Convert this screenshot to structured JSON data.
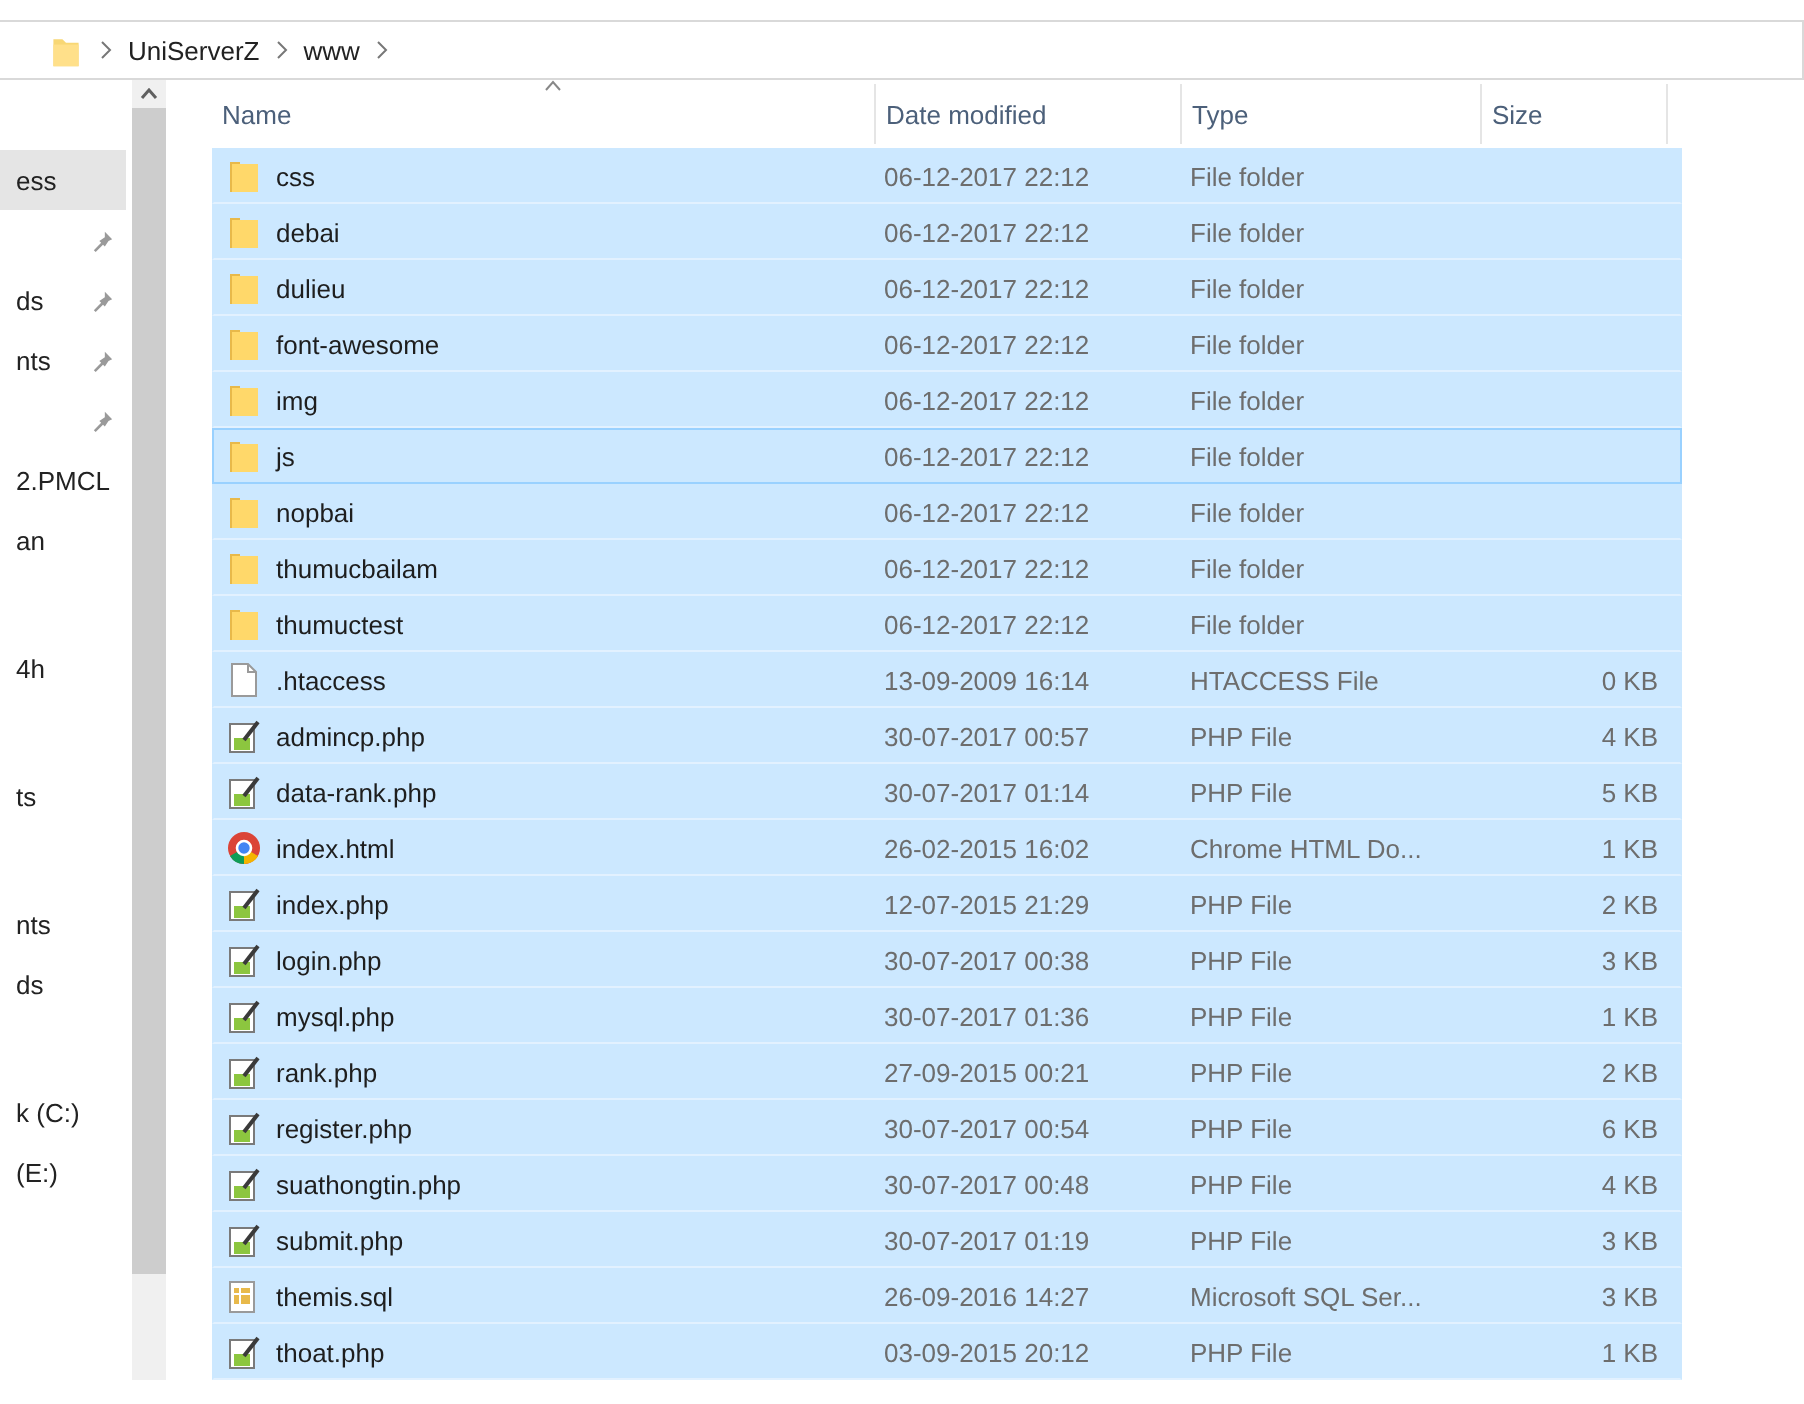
{
  "address_bar": {
    "crumbs": [
      "UniServerZ",
      "www"
    ]
  },
  "sidebar": {
    "groups": [
      {
        "items": [
          {
            "label": "ess",
            "selected": true,
            "pinned": false
          },
          {
            "pinned": true,
            "selected": false
          },
          {
            "label": "ds",
            "pinned": true,
            "selected": false
          },
          {
            "label": "nts",
            "pinned": true,
            "selected": false
          },
          {
            "pinned": true,
            "selected": false
          },
          {
            "label": "2.PMCL",
            "pinned": false,
            "selected": false
          },
          {
            "label": "an",
            "pinned": false,
            "selected": false
          }
        ]
      },
      {
        "items": [
          {
            "label": "4h",
            "pinned": false,
            "selected": false
          }
        ]
      },
      {
        "items": [
          {
            "label": "ts",
            "pinned": false,
            "selected": false
          }
        ]
      },
      {
        "items": [
          {
            "label": "nts",
            "pinned": false,
            "selected": false
          },
          {
            "label": "ds",
            "pinned": false,
            "selected": false
          }
        ]
      },
      {
        "items": [
          {
            "label": "k (C:)",
            "pinned": false,
            "selected": false
          },
          {
            "label": "(E:)",
            "pinned": false,
            "selected": false
          }
        ]
      }
    ]
  },
  "table": {
    "columns": [
      {
        "label": "Name",
        "sorted": true
      },
      {
        "label": "Date modified",
        "sorted": false
      },
      {
        "label": "Type",
        "sorted": false
      },
      {
        "label": "Size",
        "sorted": false
      }
    ],
    "rows": [
      {
        "kind": "folder",
        "name": "css",
        "date": "06-12-2017 22:12",
        "type": "File folder",
        "selected": true,
        "focused": false
      },
      {
        "kind": "folder",
        "name": "debai",
        "date": "06-12-2017 22:12",
        "type": "File folder",
        "selected": true,
        "focused": false
      },
      {
        "kind": "folder",
        "name": "dulieu",
        "date": "06-12-2017 22:12",
        "type": "File folder",
        "selected": true,
        "focused": false
      },
      {
        "kind": "folder",
        "name": "font-awesome",
        "date": "06-12-2017 22:12",
        "type": "File folder",
        "selected": true,
        "focused": false
      },
      {
        "kind": "folder",
        "name": "img",
        "date": "06-12-2017 22:12",
        "type": "File folder",
        "selected": true,
        "focused": false
      },
      {
        "kind": "folder",
        "name": "js",
        "date": "06-12-2017 22:12",
        "type": "File folder",
        "selected": true,
        "focused": true
      },
      {
        "kind": "folder",
        "name": "nopbai",
        "date": "06-12-2017 22:12",
        "type": "File folder",
        "selected": true,
        "focused": false
      },
      {
        "kind": "folder",
        "name": "thumucbailam",
        "date": "06-12-2017 22:12",
        "type": "File folder",
        "selected": true,
        "focused": false
      },
      {
        "kind": "folder",
        "name": "thumuctest",
        "date": "06-12-2017 22:12",
        "type": "File folder",
        "selected": true,
        "focused": false
      },
      {
        "kind": "file",
        "name": ".htaccess",
        "date": "13-09-2009 16:14",
        "type": "HTACCESS File",
        "size": "0 KB",
        "selected": true,
        "focused": false
      },
      {
        "kind": "php",
        "name": "admincp.php",
        "date": "30-07-2017 00:57",
        "type": "PHP File",
        "size": "4 KB",
        "selected": true,
        "focused": false
      },
      {
        "kind": "php",
        "name": "data-rank.php",
        "date": "30-07-2017 01:14",
        "type": "PHP File",
        "size": "5 KB",
        "selected": true,
        "focused": false
      },
      {
        "kind": "browser",
        "name": "index.html",
        "date": "26-02-2015 16:02",
        "type": "Chrome HTML Do...",
        "size": "1 KB",
        "selected": true,
        "focused": false
      },
      {
        "kind": "php",
        "name": "index.php",
        "date": "12-07-2015 21:29",
        "type": "PHP File",
        "size": "2 KB",
        "selected": true,
        "focused": false
      },
      {
        "kind": "php",
        "name": "login.php",
        "date": "30-07-2017 00:38",
        "type": "PHP File",
        "size": "3 KB",
        "selected": true,
        "focused": false
      },
      {
        "kind": "php",
        "name": "mysql.php",
        "date": "30-07-2017 01:36",
        "type": "PHP File",
        "size": "1 KB",
        "selected": true,
        "focused": false
      },
      {
        "kind": "php",
        "name": "rank.php",
        "date": "27-09-2015 00:21",
        "type": "PHP File",
        "size": "2 KB",
        "selected": true,
        "focused": false
      },
      {
        "kind": "php",
        "name": "register.php",
        "date": "30-07-2017 00:54",
        "type": "PHP File",
        "size": "6 KB",
        "selected": true,
        "focused": false
      },
      {
        "kind": "php",
        "name": "suathongtin.php",
        "date": "30-07-2017 00:48",
        "type": "PHP File",
        "size": "4 KB",
        "selected": true,
        "focused": false
      },
      {
        "kind": "php",
        "name": "submit.php",
        "date": "30-07-2017 01:19",
        "type": "PHP File",
        "size": "3 KB",
        "selected": true,
        "focused": false
      },
      {
        "kind": "sql",
        "name": "themis.sql",
        "date": "26-09-2016 14:27",
        "type": "Microsoft SQL Ser...",
        "size": "3 KB",
        "selected": true,
        "focused": false
      },
      {
        "kind": "php",
        "name": "thoat.php",
        "date": "03-09-2015 20:12",
        "type": "PHP File",
        "size": "1 KB",
        "selected": true,
        "focused": false
      }
    ]
  }
}
